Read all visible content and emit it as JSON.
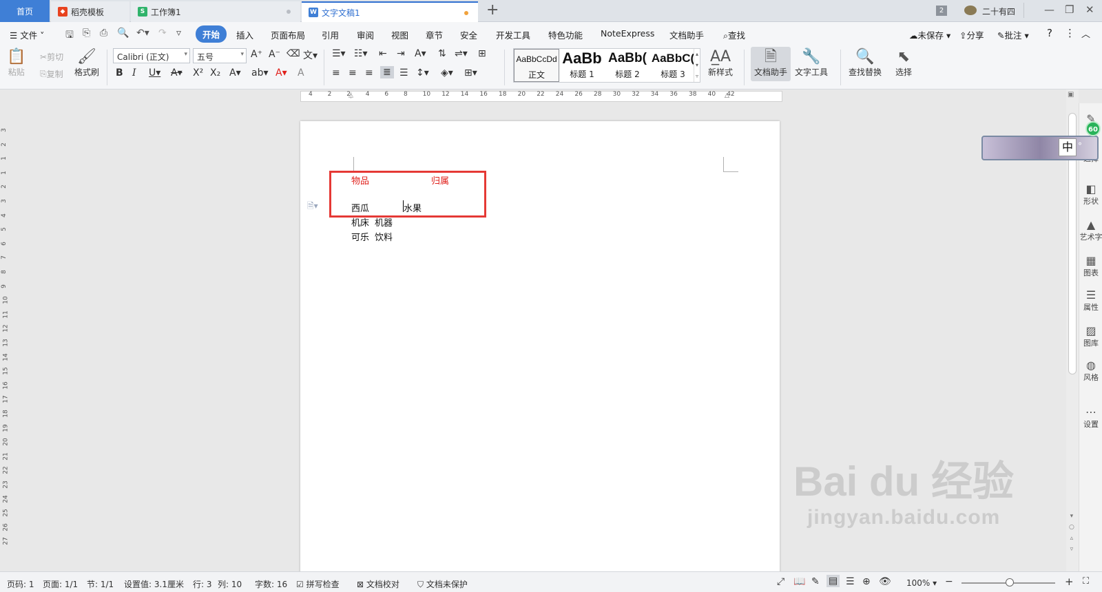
{
  "tabs": {
    "home": "首页",
    "template": "稻壳模板",
    "sheet": "工作簿1",
    "doc": "文字文稿1",
    "add": "+"
  },
  "titlebar": {
    "badge": "2",
    "user": "二十有四"
  },
  "menu": {
    "file": "文件",
    "items": [
      "开始",
      "插入",
      "页面布局",
      "引用",
      "审阅",
      "视图",
      "章节",
      "安全",
      "开发工具",
      "特色功能",
      "NoteExpress",
      "文档助手"
    ],
    "search": "查找",
    "unsaved": "未保存",
    "share": "分享",
    "comment": "批注",
    "help": "?"
  },
  "ribbon": {
    "paste": "粘贴",
    "cut": "剪切",
    "copy": "复制",
    "format_painter": "格式刷",
    "font_name": "Calibri (正文)",
    "font_size": "五号",
    "styles": [
      {
        "sample": "AaBbCcDd",
        "name": "正文"
      },
      {
        "sample": "AaBb",
        "name": "标题 1"
      },
      {
        "sample": "AaBb(",
        "name": "标题 2"
      },
      {
        "sample": "AaBbC(",
        "name": "标题 3"
      }
    ],
    "new_style": "新样式",
    "doc_assistant": "文档助手",
    "text_tools": "文字工具",
    "find_replace": "查找替换",
    "select": "选择"
  },
  "ruler": {
    "h_ticks": [
      "4",
      "2",
      "2",
      "4",
      "6",
      "8",
      "10",
      "12",
      "14",
      "16",
      "18",
      "20",
      "22",
      "24",
      "26",
      "28",
      "30",
      "32",
      "34",
      "36",
      "38",
      "40",
      "42"
    ],
    "v_ticks": [
      "3",
      "2",
      "1",
      "1",
      "2",
      "3",
      "4",
      "5",
      "6",
      "7",
      "8",
      "9",
      "10",
      "11",
      "12",
      "13",
      "14",
      "15",
      "16",
      "17",
      "18",
      "19",
      "20",
      "21",
      "22",
      "23",
      "24",
      "25",
      "26",
      "27"
    ]
  },
  "document": {
    "header": {
      "col1": "物品",
      "col2": "归属"
    },
    "rows": [
      {
        "item": "西瓜",
        "owner": "水果"
      },
      {
        "item": "机床",
        "owner": "机器"
      },
      {
        "item": "可乐",
        "owner": "饮料"
      }
    ]
  },
  "sidebar": {
    "badge": "60",
    "ime_label": "中",
    "items": [
      "选择",
      "形状",
      "艺术字",
      "图表",
      "属性",
      "图库",
      "风格",
      "设置"
    ]
  },
  "status": {
    "page_no": "页码: 1",
    "pages": "页面: 1/1",
    "section": "节: 1/1",
    "setting": "设置值: 3.1厘米",
    "row": "行: 3",
    "col": "列: 10",
    "words": "字数: 16",
    "spell": "拼写检查",
    "proof": "文档校对",
    "protect": "文档未保护",
    "zoom": "100%"
  },
  "watermark": {
    "brand": "Bai du 经验",
    "url": "jingyan.baidu.com"
  },
  "colors": {
    "accent": "#3f7fd6",
    "highlight_box": "#e53935",
    "header_text": "#e0201b"
  }
}
